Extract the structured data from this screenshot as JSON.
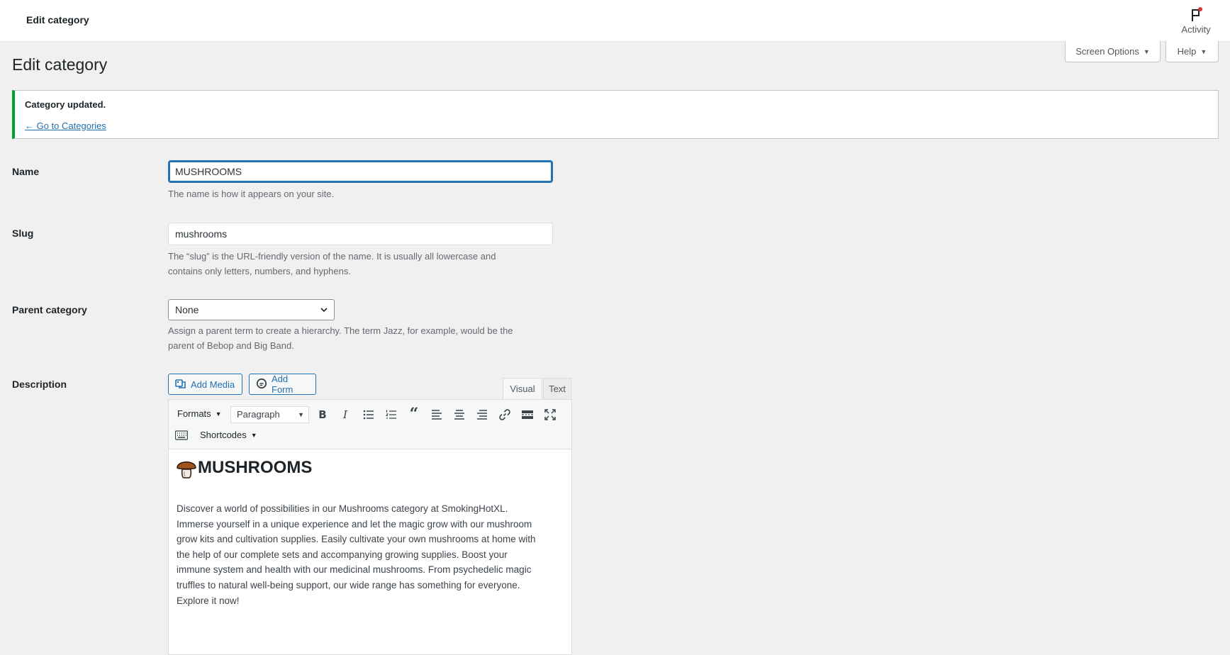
{
  "topbar": {
    "title": "Edit category",
    "activity_label": "Activity"
  },
  "screen_options": {
    "label": "Screen Options"
  },
  "help": {
    "label": "Help"
  },
  "page": {
    "heading": "Edit category"
  },
  "notice": {
    "message": "Category updated.",
    "link": "← Go to Categories",
    "accent": "#00a32a"
  },
  "form": {
    "name": {
      "label": "Name",
      "value": "MUSHROOMS",
      "description": "The name is how it appears on your site."
    },
    "slug": {
      "label": "Slug",
      "value": "mushrooms",
      "description_line1": "The “slug” is the URL-friendly version of the name. It is usually all lowercase and",
      "description_line2": "contains only letters, numbers, and hyphens."
    },
    "parent": {
      "label": "Parent category",
      "selected": "None",
      "description_line1": "Assign a parent term to create a hierarchy. The term Jazz, for example, would be the",
      "description_line2": "parent of Bebop and Big Band."
    },
    "description": {
      "label": "Description"
    }
  },
  "editor": {
    "add_media": "Add Media",
    "add_form": "Add Form",
    "tab_visual": "Visual",
    "tab_text": "Text",
    "formats": "Formats",
    "paragraph": "Paragraph",
    "shortcodes": "Shortcodes",
    "content_heading": "MUSHROOMS",
    "content_lines": [
      "Discover a world of possibilities in our Mushrooms category at SmokingHotXL.",
      "Immerse yourself in a unique experience and let the magic grow with our mushroom",
      "grow kits and cultivation supplies. Easily cultivate your own mushrooms at home with",
      "the help of our complete sets and accompanying growing supplies. Boost your",
      "immune system and health with our medicinal mushrooms. From psychedelic magic",
      "truffles to natural well-being support, our wide range has something for everyone.",
      "Explore it now!"
    ]
  },
  "colors": {
    "link": "#2271b1",
    "focus": "#2271b1",
    "background": "#f0f0f1"
  }
}
